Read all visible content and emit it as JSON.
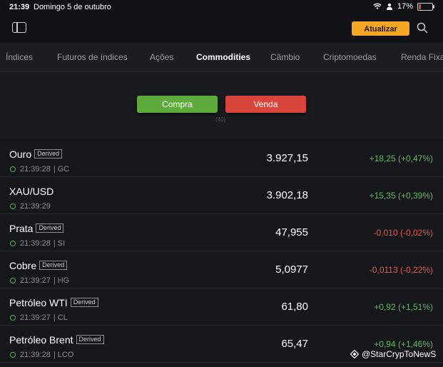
{
  "status_bar": {
    "time": "21:39",
    "date": "Domingo 5 de outubro",
    "battery": "17%",
    "battery_level": 0.17
  },
  "header": {
    "update_label": "Atualizar",
    "accent_color": "#f5a623"
  },
  "tabs": [
    {
      "label": "Índices"
    },
    {
      "label": "Futuros de índices"
    },
    {
      "label": "Ações"
    },
    {
      "label": "Commodities",
      "active": true
    },
    {
      "label": "Câmbio"
    },
    {
      "label": "Criptomoedas"
    },
    {
      "label": "Renda Fixa"
    }
  ],
  "ad": {
    "buy_label": "Compra",
    "sell_label": "Venda",
    "ad_marker": "(40)",
    "buy_color": "#5cab3c",
    "sell_color": "#d9443c"
  },
  "quotes": [
    {
      "name": "Ouro",
      "derived": "Derived",
      "time": "21:39:28",
      "symbol": "| GC",
      "price": "3.927,15",
      "change": "+18,25 (+0,47%)",
      "direction": "up"
    },
    {
      "name": "XAU/USD",
      "derived": "",
      "time": "21:39:29",
      "symbol": "",
      "price": "3.902,18",
      "change": "+15,35 (+0,39%)",
      "direction": "up"
    },
    {
      "name": "Prata",
      "derived": "Derived",
      "time": "21:39:28",
      "symbol": "| SI",
      "price": "47,955",
      "change": "-0,010 (-0,02%)",
      "direction": "down"
    },
    {
      "name": "Cobre",
      "derived": "Derived",
      "time": "21:39:27",
      "symbol": "| HG",
      "price": "5,0977",
      "change": "-0,0113 (-0,22%)",
      "direction": "down"
    },
    {
      "name": "Petróleo WTI",
      "derived": "Derived",
      "time": "21:39:27",
      "symbol": "| CL",
      "price": "61,80",
      "change": "+0,92 (+1,51%)",
      "direction": "up"
    },
    {
      "name": "Petróleo Brent",
      "derived": "Derived",
      "time": "21:39:28",
      "symbol": "| LCO",
      "price": "65,47",
      "change": "+0,94 (+1,46%)",
      "direction": "up"
    }
  ],
  "watermark": "@StarCrypToNewS",
  "colors": {
    "positive": "#5cb85c",
    "negative": "#e05a4c",
    "background": "#16171b"
  }
}
